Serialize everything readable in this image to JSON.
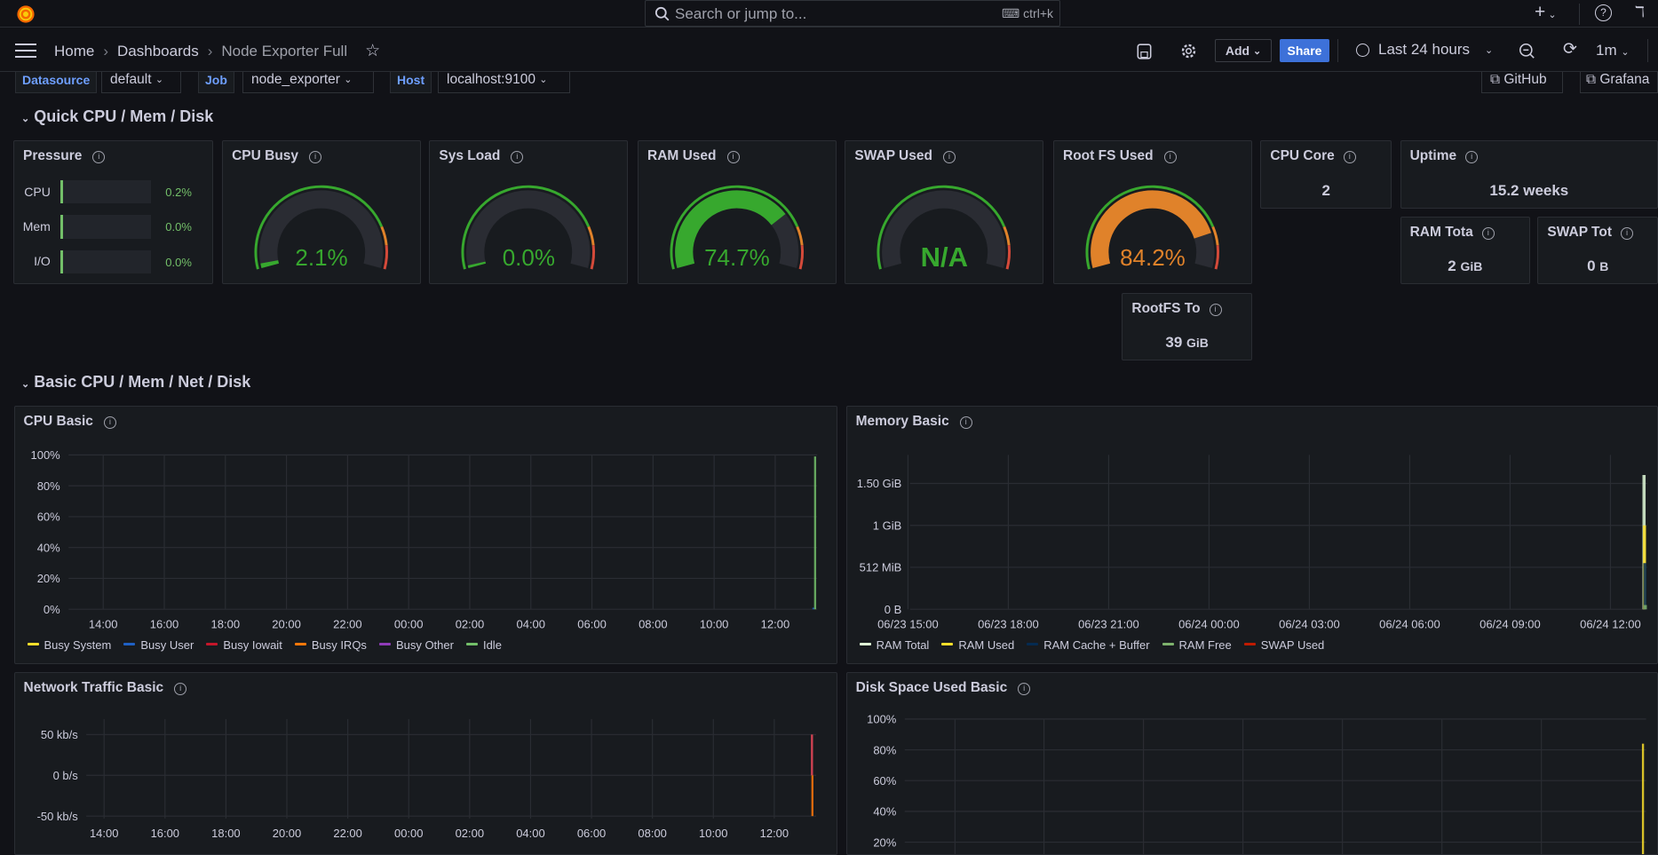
{
  "topbar": {
    "search_placeholder": "Search or jump to...",
    "search_shortcut": "ctrl+k"
  },
  "nav": {
    "breadcrumb": [
      "Home",
      "Dashboards",
      "Node Exporter Full"
    ],
    "add_label": "Add",
    "share_label": "Share",
    "time_range": "Last 24 hours",
    "refresh_interval": "1m",
    "accent": "#3d71d9"
  },
  "variables": [
    {
      "label": "Datasource",
      "value": "default"
    },
    {
      "label": "Job",
      "value": "node_exporter"
    },
    {
      "label": "Host",
      "value": "localhost:9100"
    }
  ],
  "links": [
    "GitHub",
    "Grafana"
  ],
  "rows": [
    "Quick CPU / Mem / Disk",
    "Basic CPU / Mem / Net / Disk"
  ],
  "pressure": {
    "title": "Pressure",
    "items": [
      {
        "label": "CPU",
        "value": "0.2%",
        "fraction": 0.002
      },
      {
        "label": "Mem",
        "value": "0.0%",
        "fraction": 0
      },
      {
        "label": "I/O",
        "value": "0.0%",
        "fraction": 0
      }
    ]
  },
  "gauges": [
    {
      "title": "CPU Busy",
      "value": "2.1%",
      "percent": 2.1,
      "color": "#37a82e"
    },
    {
      "title": "Sys Load",
      "value": "0.0%",
      "percent": 0,
      "color": "#37a82e"
    },
    {
      "title": "RAM Used",
      "value": "74.7%",
      "percent": 74.7,
      "color": "#37a82e"
    },
    {
      "title": "SWAP Used",
      "value": "N/A",
      "percent": null,
      "color": "#37a82e"
    },
    {
      "title": "Root FS Used",
      "value": "84.2%",
      "percent": 84.2,
      "color": "#e0822a"
    }
  ],
  "stats": [
    {
      "title": "CPU Core",
      "value": "2"
    },
    {
      "title": "Uptime",
      "value": "15.2 weeks"
    },
    {
      "title": "RAM Tota",
      "value": "2",
      "unit": "GiB"
    },
    {
      "title": "SWAP Tot",
      "value": "0",
      "unit": "B"
    },
    {
      "title": "RootFS To",
      "value": "39",
      "unit": "GiB"
    }
  ],
  "chart_data": [
    {
      "type": "line",
      "title": "CPU Basic",
      "ylim": [
        0,
        100
      ],
      "yticks": [
        0,
        20,
        40,
        60,
        80,
        100
      ],
      "ytick_labels": [
        "0%",
        "20%",
        "40%",
        "60%",
        "80%",
        "100%"
      ],
      "xtick_labels": [
        "14:00",
        "16:00",
        "18:00",
        "20:00",
        "22:00",
        "00:00",
        "02:00",
        "04:00",
        "06:00",
        "08:00",
        "10:00",
        "12:00"
      ],
      "series": [
        {
          "name": "Busy System",
          "color": "#fade2a",
          "last": 0
        },
        {
          "name": "Busy User",
          "color": "#1f60c4",
          "last": 1
        },
        {
          "name": "Busy Iowait",
          "color": "#c4162a",
          "last": 0
        },
        {
          "name": "Busy IRQs",
          "color": "#ff780a",
          "last": 0
        },
        {
          "name": "Busy Other",
          "color": "#8f3bb8",
          "last": 0
        },
        {
          "name": "Idle",
          "color": "#73bf69",
          "last": 99
        }
      ]
    },
    {
      "type": "area",
      "title": "Memory Basic",
      "ylim": [
        0,
        1.84
      ],
      "yticks": [
        0,
        0.5,
        1,
        1.5
      ],
      "ytick_labels": [
        "0 B",
        "512 MiB",
        "1 GiB",
        "1.50 GiB"
      ],
      "xtick_labels": [
        "06/23 15:00",
        "06/23 18:00",
        "06/23 21:00",
        "06/24 00:00",
        "06/24 03:00",
        "06/24 06:00",
        "06/24 09:00",
        "06/24 12:00"
      ],
      "series": [
        {
          "name": "RAM Total",
          "color": "#e0f9d7",
          "last": 1.6
        },
        {
          "name": "RAM Used",
          "color": "#fade2a",
          "last": 1.0
        },
        {
          "name": "RAM Cache + Buffer",
          "color": "#052b51",
          "last": 0.55
        },
        {
          "name": "RAM Free",
          "color": "#7eb26d",
          "last": 0.05
        },
        {
          "name": "SWAP Used",
          "color": "#bf1b00",
          "last": 0
        }
      ]
    },
    {
      "type": "line",
      "title": "Network Traffic Basic",
      "ylim": [
        -53,
        69
      ],
      "yticks": [
        -50,
        0,
        50
      ],
      "ytick_labels": [
        "-50 kb/s",
        "0 b/s",
        "50 kb/s"
      ],
      "xtick_labels": [
        "14:00",
        "16:00",
        "18:00",
        "20:00",
        "22:00",
        "00:00",
        "02:00",
        "04:00",
        "06:00",
        "08:00",
        "10:00",
        "12:00"
      ],
      "series": [
        {
          "color": "#f2495c",
          "last": 50
        },
        {
          "color": "#ff780a",
          "last": -50
        }
      ]
    },
    {
      "type": "line",
      "title": "Disk Space Used Basic",
      "ylim": [
        0,
        100
      ],
      "yticks": [
        20,
        40,
        60,
        80,
        100
      ],
      "ytick_labels": [
        "20%",
        "40%",
        "60%",
        "80%",
        "100%"
      ],
      "series": [
        {
          "color": "#fade2a",
          "last": 84
        }
      ]
    }
  ]
}
